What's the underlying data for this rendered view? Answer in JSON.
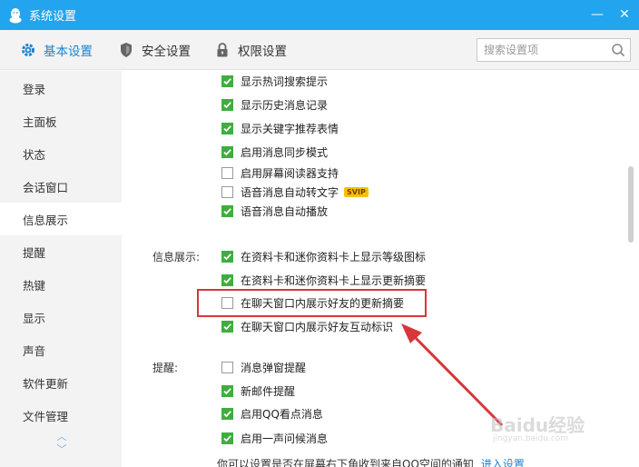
{
  "window": {
    "title": "系统设置",
    "minimize": "—",
    "close": "✕"
  },
  "tabs": [
    {
      "label": "基本设置",
      "icon": "gear-icon",
      "active": true
    },
    {
      "label": "安全设置",
      "icon": "shield-icon",
      "active": false
    },
    {
      "label": "权限设置",
      "icon": "lock-icon",
      "active": false
    }
  ],
  "search": {
    "placeholder": "搜索设置项"
  },
  "sidebar": {
    "items": [
      {
        "label": "登录"
      },
      {
        "label": "主面板"
      },
      {
        "label": "状态"
      },
      {
        "label": "会话窗口"
      },
      {
        "label": "信息展示",
        "active": true
      },
      {
        "label": "提醒"
      },
      {
        "label": "热键"
      },
      {
        "label": "显示"
      },
      {
        "label": "声音"
      },
      {
        "label": "软件更新"
      },
      {
        "label": "文件管理"
      }
    ],
    "scroll_up": "︿",
    "scroll_down": "﹀"
  },
  "options_top": [
    {
      "label": "显示热词搜索提示",
      "checked": true
    },
    {
      "label": "显示历史消息记录",
      "checked": true
    },
    {
      "label": "显示关键字推荐表情",
      "checked": true
    },
    {
      "label": "启用消息同步模式",
      "checked": true
    },
    {
      "label": "启用屏幕阅读器支持",
      "checked": false
    },
    {
      "label": "语音消息自动转文字",
      "checked": false,
      "badge": "SVIP"
    },
    {
      "label": "语音消息自动播放",
      "checked": true
    }
  ],
  "info_section": {
    "label": "信息展示:",
    "options": [
      {
        "label": "在资料卡和迷你资料卡上显示等级图标",
        "checked": true
      },
      {
        "label": "在资料卡和迷你资料卡上显示更新摘要",
        "checked": true
      },
      {
        "label": "在聊天窗口内展示好友的更新摘要",
        "checked": false
      },
      {
        "label": "在聊天窗口内展示好友互动标识",
        "checked": true
      }
    ]
  },
  "remind_section": {
    "label": "提醒:",
    "options": [
      {
        "label": "消息弹窗提醒",
        "checked": false
      },
      {
        "label": "新邮件提醒",
        "checked": true
      },
      {
        "label": "启用QQ看点消息",
        "checked": true
      },
      {
        "label": "启用一声问候消息",
        "checked": true
      }
    ]
  },
  "footer": {
    "note": "你可以设置是否在屏幕右下角收到来自QQ空间的通知",
    "link": "进入设置"
  },
  "watermark": {
    "text": "Baidu经验",
    "sub": "jingyan.baidu.com"
  },
  "colors": {
    "titlebar": "#22a4ef",
    "accent": "#1d83cf",
    "checked": "#3fae3f",
    "highlight": "#d7373a"
  }
}
